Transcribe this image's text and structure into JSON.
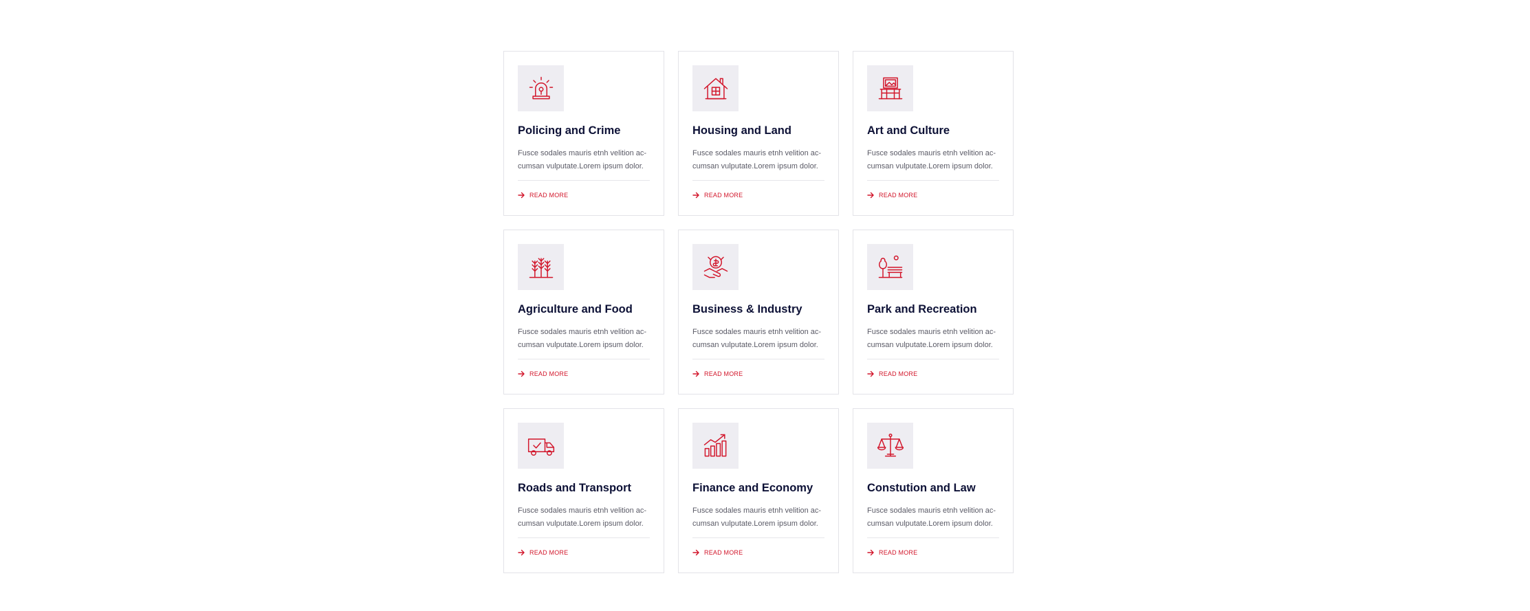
{
  "accent_color": "#d2152a",
  "title_color": "#0d1136",
  "cards": [
    {
      "icon": "police-siren-icon",
      "title": "Policing and Crime",
      "desc": "Fusce sodales mauris etnh velition ac-cumsan vulputate.Lorem ipsum dolor.",
      "link": "READ MORE"
    },
    {
      "icon": "house-icon",
      "title": "Housing and Land",
      "desc": "Fusce sodales mauris etnh velition ac-cumsan vulputate.Lorem ipsum dolor.",
      "link": "READ MORE"
    },
    {
      "icon": "art-frame-icon",
      "title": "Art and Culture",
      "desc": "Fusce sodales mauris etnh velition ac-cumsan vulputate.Lorem ipsum dolor.",
      "link": "READ MORE"
    },
    {
      "icon": "wheat-icon",
      "title": "Agriculture and Food",
      "desc": "Fusce sodales mauris etnh velition ac-cumsan vulputate.Lorem ipsum dolor.",
      "link": "READ MORE"
    },
    {
      "icon": "handshake-money-icon",
      "title": "Business & Industry",
      "desc": "Fusce sodales mauris etnh velition ac-cumsan vulputate.Lorem ipsum dolor.",
      "link": "READ MORE"
    },
    {
      "icon": "park-bench-icon",
      "title": "Park and Recreation",
      "desc": "Fusce sodales mauris etnh velition ac-cumsan vulputate.Lorem ipsum dolor.",
      "link": "READ MORE"
    },
    {
      "icon": "delivery-truck-icon",
      "title": "Roads and Transport",
      "desc": "Fusce sodales mauris etnh velition ac-cumsan vulputate.Lorem ipsum dolor.",
      "link": "READ MORE"
    },
    {
      "icon": "growth-chart-icon",
      "title": "Finance and Economy",
      "desc": "Fusce sodales mauris etnh velition ac-cumsan vulputate.Lorem ipsum dolor.",
      "link": "READ MORE"
    },
    {
      "icon": "justice-scale-icon",
      "title": "Constution and Law",
      "desc": "Fusce sodales mauris etnh velition ac-cumsan vulputate.Lorem ipsum dolor.",
      "link": "READ MORE"
    }
  ]
}
